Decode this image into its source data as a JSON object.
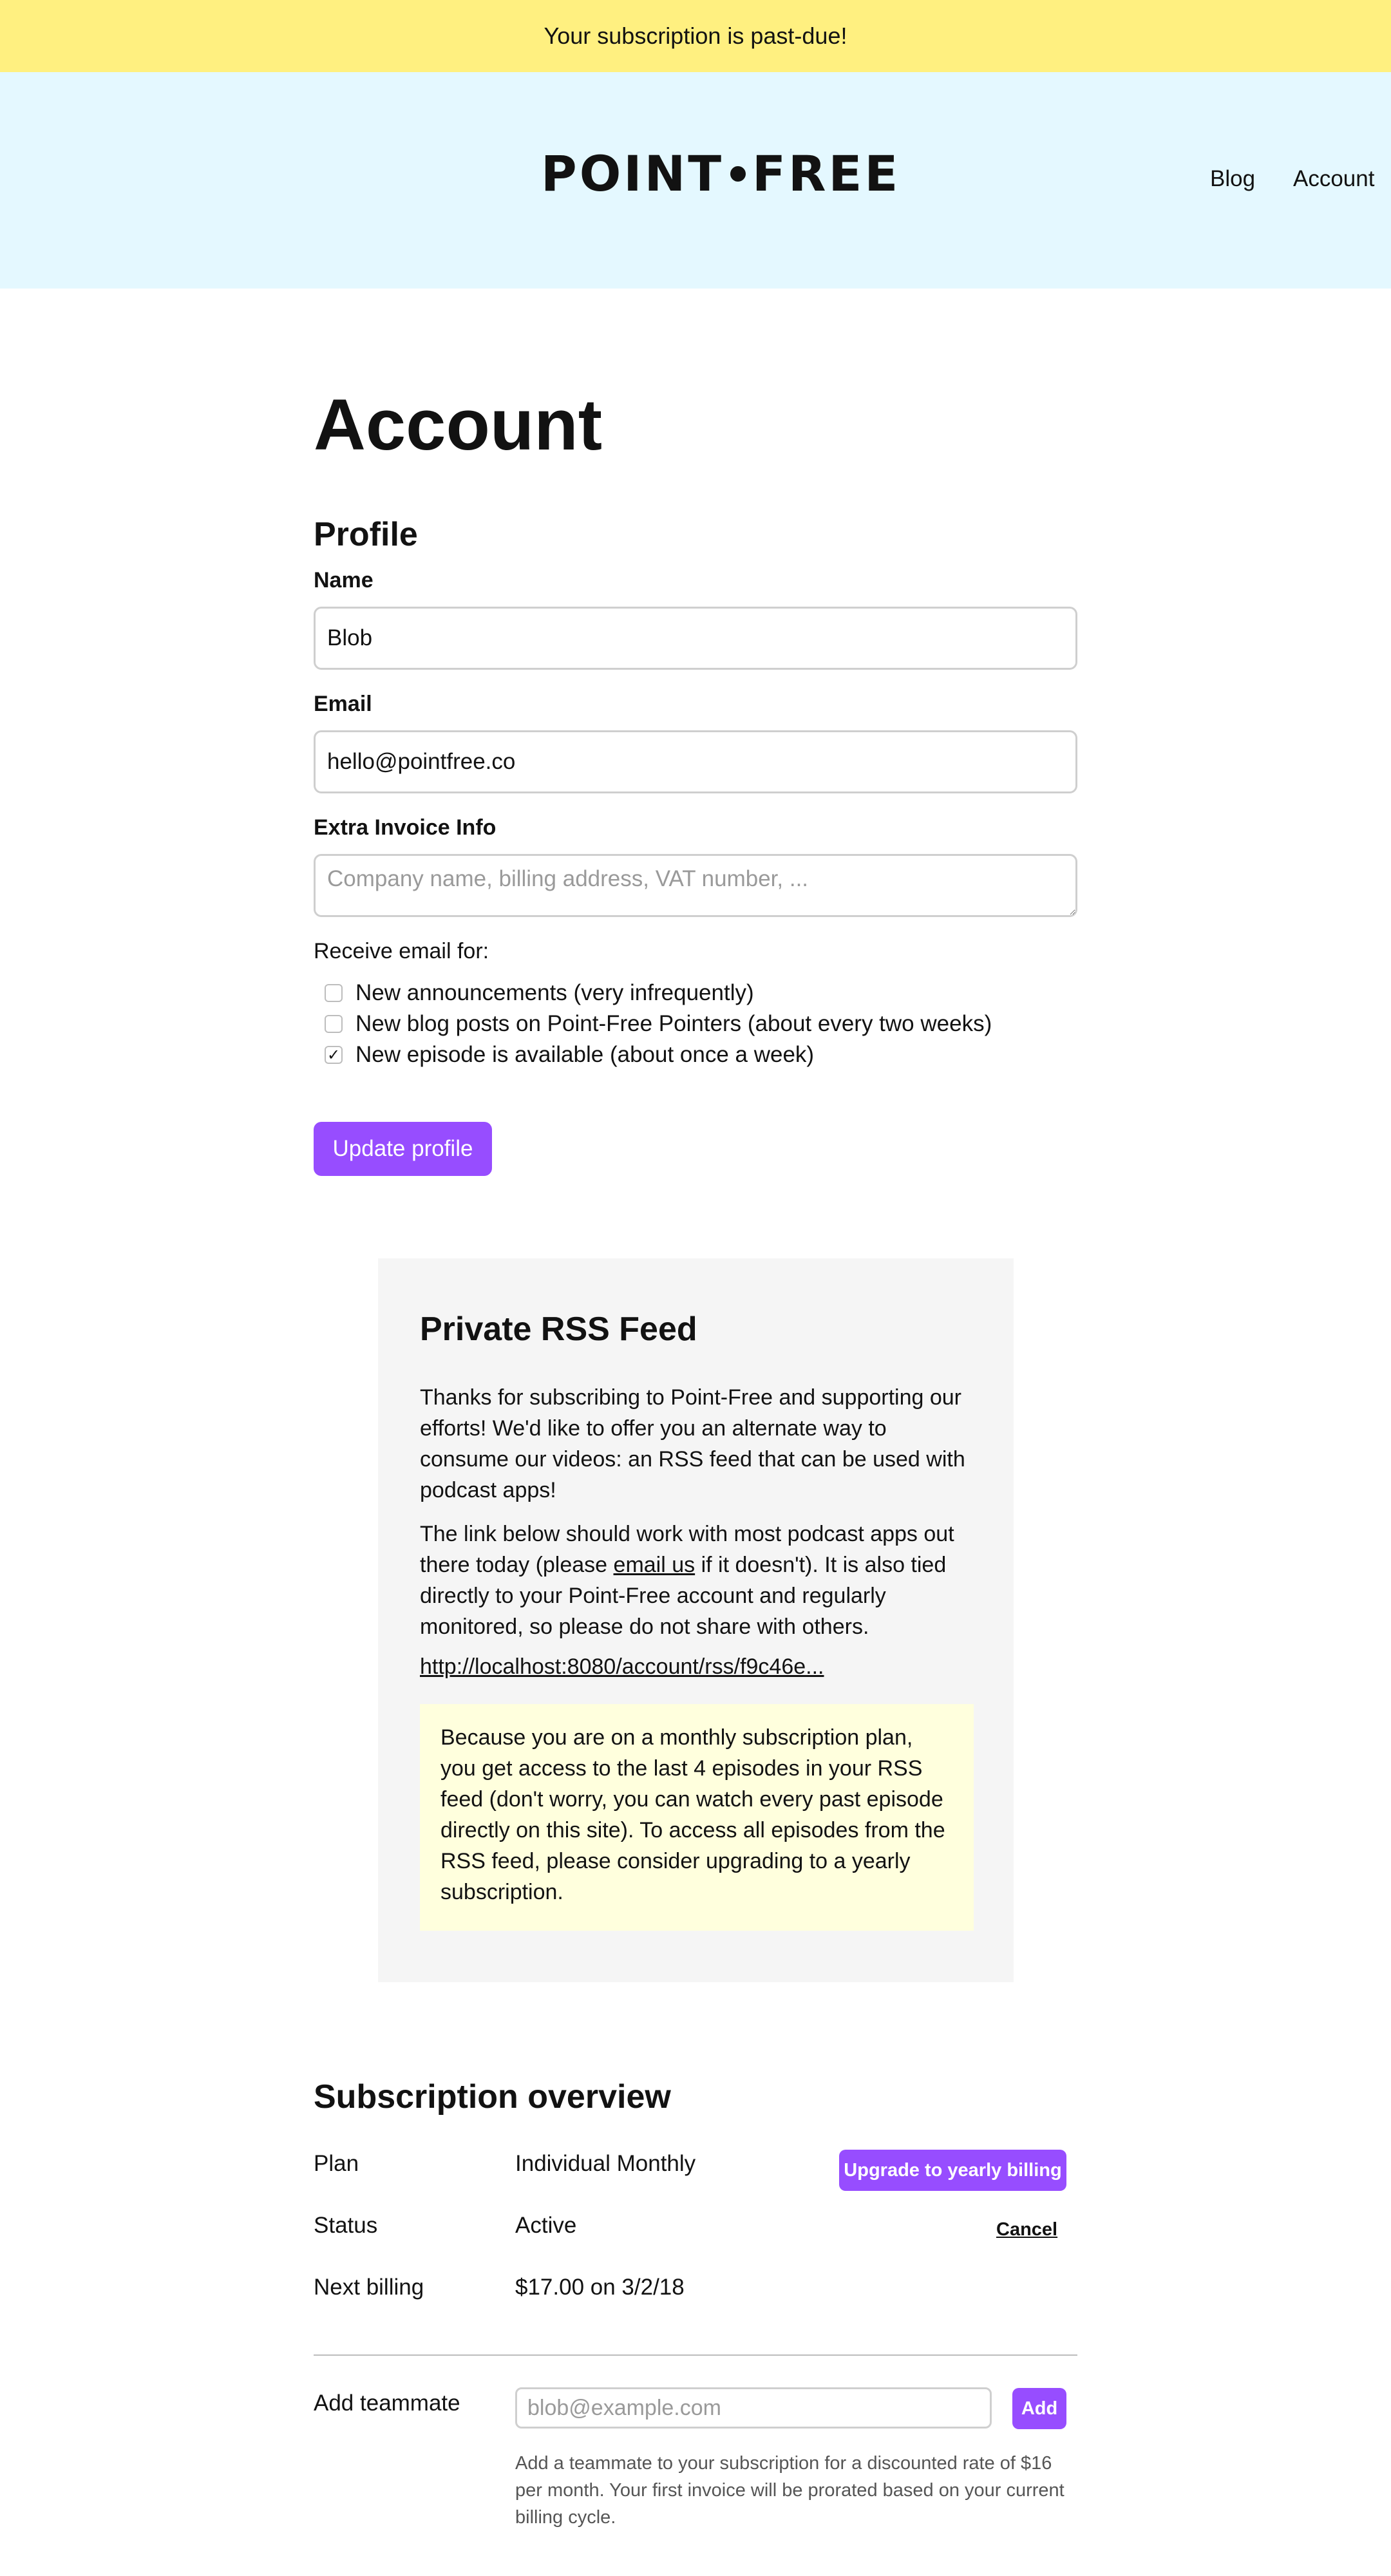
{
  "banner": {
    "text": "Your subscription is past-due!"
  },
  "header": {
    "logo_left": "POINT",
    "logo_right": "FREE",
    "nav": {
      "blog": "Blog",
      "account": "Account"
    }
  },
  "page": {
    "title": "Account"
  },
  "profile": {
    "heading": "Profile",
    "name_label": "Name",
    "name_value": "Blob",
    "email_label": "Email",
    "email_value": "hello@pointfree.co",
    "invoice_label": "Extra Invoice Info",
    "invoice_placeholder": "Company name, billing address, VAT number, ...",
    "prefs_title": "Receive email for:",
    "prefs": [
      {
        "label": "New announcements (very infrequently)",
        "checked": false
      },
      {
        "label": "New blog posts on Point-Free Pointers (about every two weeks)",
        "checked": false
      },
      {
        "label": "New episode is available (about once a week)",
        "checked": true
      }
    ],
    "update_button": "Update profile"
  },
  "rss": {
    "heading": "Private RSS Feed",
    "para1": "Thanks for subscribing to Point-Free and supporting our efforts! We'd like to offer you an alternate way to consume our videos: an RSS feed that can be used with podcast apps!",
    "para2_before": "The link below should work with most podcast apps out there today (please ",
    "para2_link": "email us",
    "para2_after": " if it doesn't). It is also tied directly to your Point-Free account and regularly monitored, so please do not share with others.",
    "feed_url": "http://localhost:8080/account/rss/f9c46e...",
    "note": "Because you are on a monthly subscription plan, you get access to the last 4 episodes in your RSS feed (don't worry, you can watch every past episode directly on this site). To access all episodes from the RSS feed, please consider upgrading to a yearly subscription."
  },
  "subscription": {
    "heading": "Subscription overview",
    "plan_label": "Plan",
    "plan_value": "Individual Monthly",
    "upgrade_button": "Upgrade to yearly billing",
    "status_label": "Status",
    "status_value": "Active",
    "cancel_link": "Cancel",
    "billing_label": "Next billing",
    "billing_value": "$17.00 on 3/2/18",
    "teammate_label": "Add teammate",
    "teammate_placeholder": "blob@example.com",
    "add_button": "Add",
    "teammate_help": "Add a teammate to your subscription for a discounted rate of $16 per month. Your first invoice will be prorated based on your current billing cycle."
  },
  "colors": {
    "banner_bg": "#fff080",
    "header_bg": "#e4f8ff",
    "accent": "#974dff",
    "panel_bg": "#f5f5f5",
    "note_bg": "#ffffdd"
  }
}
